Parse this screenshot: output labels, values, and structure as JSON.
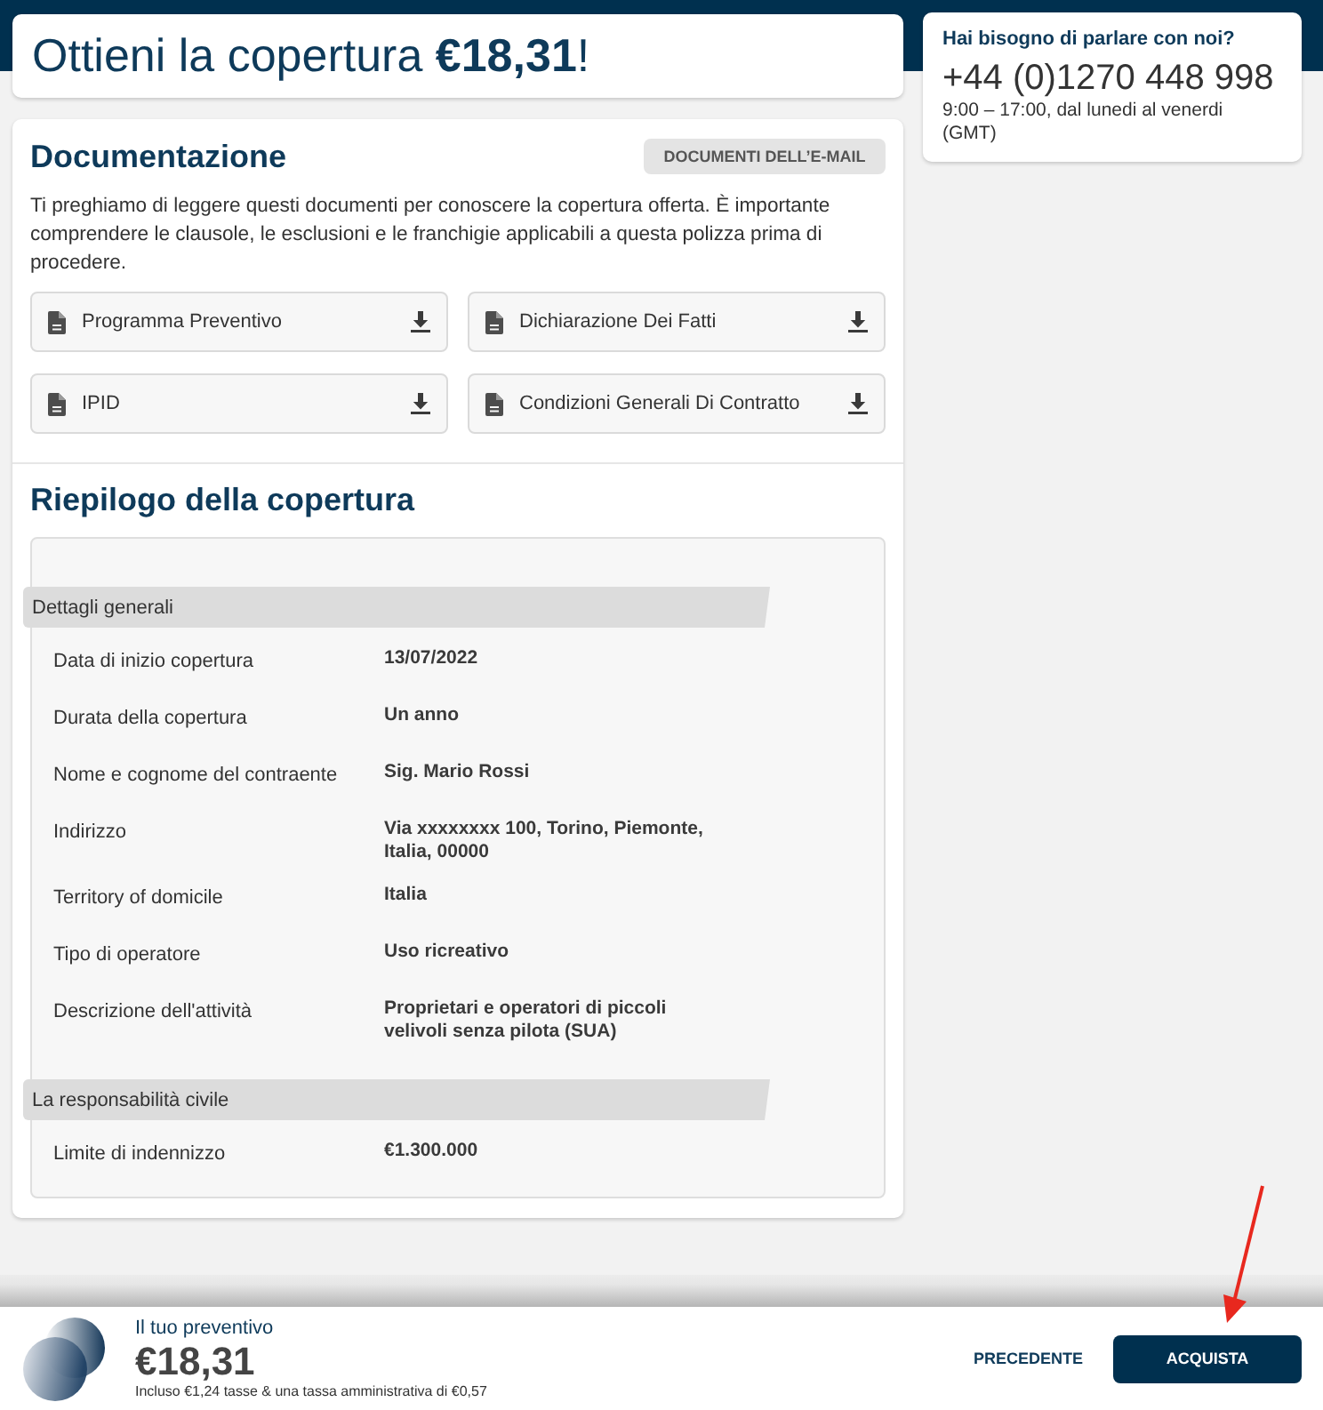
{
  "header": {
    "title": "Ottieni la copertura **€18,31**!"
  },
  "documentation": {
    "heading": "Documentazione",
    "email_button": "DOCUMENTI DELL’E-MAIL",
    "intro": "Ti preghiamo di leggere questi documenti per conoscere la copertura offerta. È importante comprendere le clausole, le esclusioni e le franchigie applicabili a questa polizza prima di procedere.",
    "documents": [
      {
        "label": "Programma Preventivo"
      },
      {
        "label": "Dichiarazione Dei Fatti"
      },
      {
        "label": "IPID"
      },
      {
        "label": "Condizioni Generali Di Contratto"
      }
    ]
  },
  "summary": {
    "heading": "Riepilogo della copertura",
    "sections": [
      {
        "title": "Dettagli generali",
        "rows": [
          {
            "label": "Data di inizio copertura",
            "value": "13/07/2022"
          },
          {
            "label": "Durata della copertura",
            "value": "Un anno"
          },
          {
            "label": "Nome e cognome del contraente",
            "value": "Sig. Mario Rossi"
          },
          {
            "label": "Indirizzo",
            "value": "Via xxxxxxxx 100, Torino, Piemonte, Italia, 00000"
          },
          {
            "label": "Territory of domicile",
            "value": "Italia"
          },
          {
            "label": "Tipo di operatore",
            "value": "Uso ricreativo"
          },
          {
            "label": "Descrizione dell'attività",
            "value": "Proprietari e operatori di piccoli velivoli senza pilota (SUA)"
          }
        ]
      },
      {
        "title": "La responsabilità civile",
        "rows": [
          {
            "label": "Limite di indennizzo",
            "value": "€1.300.000"
          }
        ]
      }
    ]
  },
  "contact": {
    "heading": "Hai bisogno di parlare con noi?",
    "phone": "+44 (0)1270 448 998",
    "hours": "9:00 – 17:00, dal lunedi al venerdi (GMT)"
  },
  "quote_bar": {
    "label": "Il tuo preventivo",
    "price": "€18,31",
    "note": "Incluso €1,24 tasse & una tassa amministrativa di €0,57",
    "buttons": [
      {
        "label": "PRECEDENTE",
        "kind": "link"
      },
      {
        "label": "ACQUISTA",
        "kind": "primary"
      }
    ]
  }
}
